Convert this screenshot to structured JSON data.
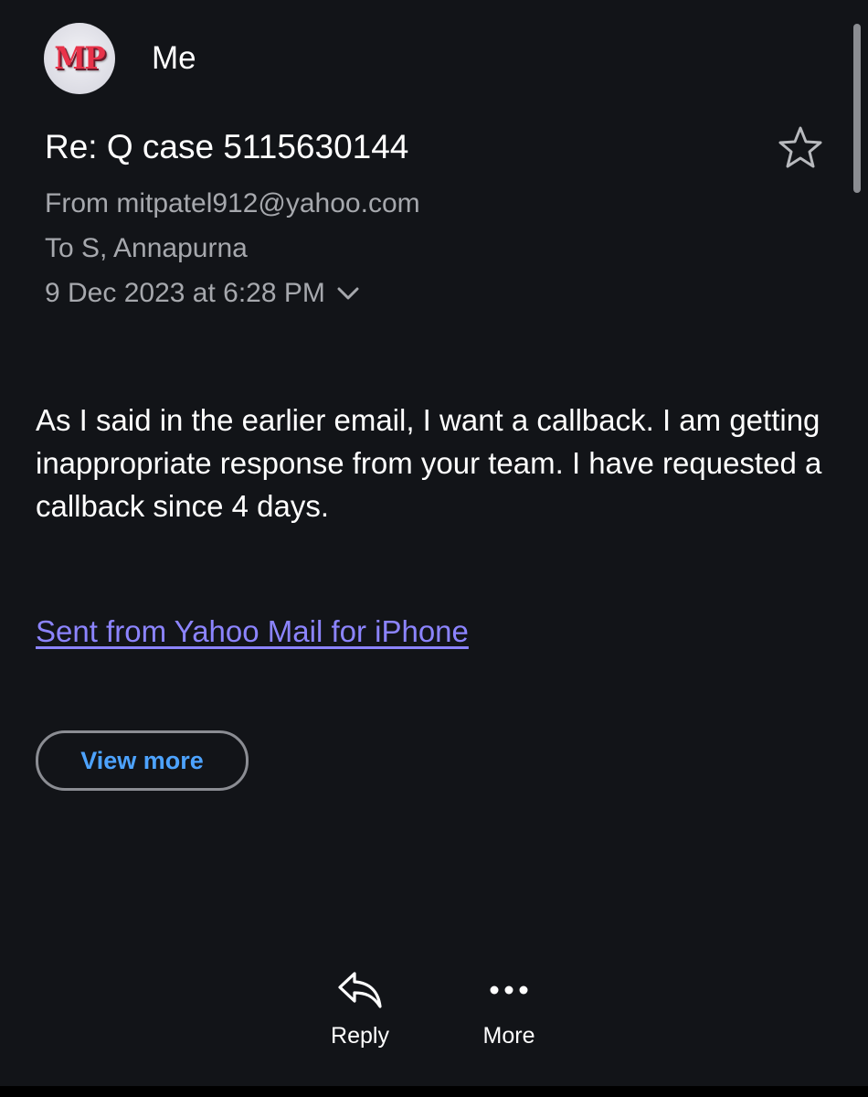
{
  "header": {
    "avatar_initials": "MP",
    "sender_name": "Me"
  },
  "email": {
    "subject": "Re: Q case 5115630144",
    "from": "From mitpatel912@yahoo.com",
    "to": "To S, Annapurna",
    "date": "9 Dec 2023 at 6:28 PM",
    "body": "As I said in the earlier email, I want a callback. I am getting inappropriate response from your team. I have requested a callback since 4 days.",
    "signature": "Sent from Yahoo Mail for iPhone",
    "view_more_label": "View more"
  },
  "actions": {
    "reply_label": "Reply",
    "more_label": "More"
  },
  "icons": {
    "star": "star-outline-icon",
    "chevron": "chevron-down-icon",
    "reply": "reply-arrow-icon",
    "more": "ellipsis-icon"
  },
  "colors": {
    "background": "#121418",
    "link": "#8c84ff",
    "button_text": "#4da3ff",
    "secondary_text": "#a6a8ad",
    "avatar_text": "#e8334a"
  }
}
